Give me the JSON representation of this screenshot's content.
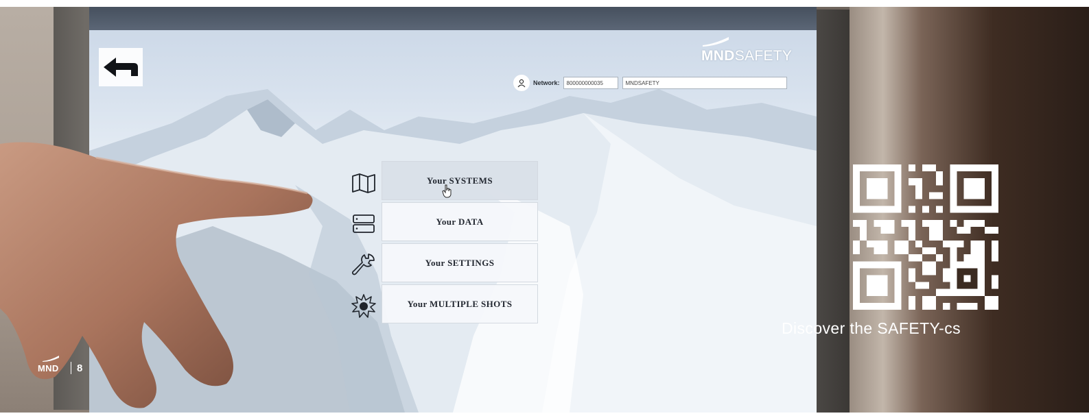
{
  "app": {
    "logo_bold": "MND",
    "logo_light": "SAFETY",
    "network_label": "Network:",
    "network_id": "800000000035",
    "network_name": "MNDSAFETY"
  },
  "menu": {
    "items": [
      {
        "label": "Your SYSTEMS",
        "icon": "map-icon",
        "active": true
      },
      {
        "label": "Your DATA",
        "icon": "server-icon",
        "active": false
      },
      {
        "label": "Your SETTINGS",
        "icon": "wrench-icon",
        "active": false
      },
      {
        "label": "Your MULTIPLE SHOTS",
        "icon": "explosion-icon",
        "active": false
      }
    ]
  },
  "slide": {
    "caption": "Discover the SAFETY-cs",
    "footer_logo": "MND",
    "page_number": "8"
  },
  "colors": {
    "accent": "#ffffff",
    "screen_sky": "#d8e2ee",
    "menu_button": "#f6f8fb"
  }
}
